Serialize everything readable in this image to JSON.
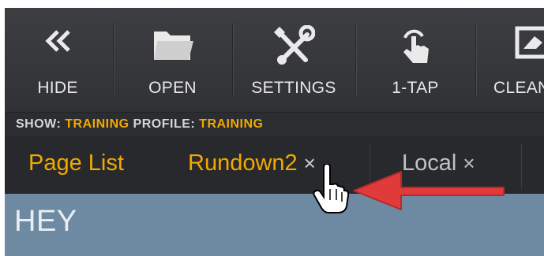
{
  "toolbar": {
    "hide_label": "HIDE",
    "open_label": "OPEN",
    "settings_label": "SETTINGS",
    "onetap_label": "1-TAP",
    "clean_label": "CLEAN"
  },
  "showbar": {
    "show_key": "SHOW:",
    "show_value": "TRAINING",
    "profile_key": "PROFILE:",
    "profile_value": "TRAINING"
  },
  "tabs": [
    {
      "label": "Page List",
      "closable": false
    },
    {
      "label": "Rundown2",
      "closable": true
    },
    {
      "label": "Local",
      "closable": true
    }
  ],
  "tab_close_glyph": "×",
  "content": {
    "title": "HEY"
  },
  "colors": {
    "accent": "#f2a900",
    "toolbar": "#333538",
    "content": "#6e8aa3",
    "arrow": "#e03a3a"
  },
  "icons": {
    "hide": "double-chevron-left-icon",
    "open": "folder-icon",
    "settings": "wrench-screwdriver-icon",
    "onetap": "tap-hand-icon",
    "clean": "eraser-icon"
  }
}
